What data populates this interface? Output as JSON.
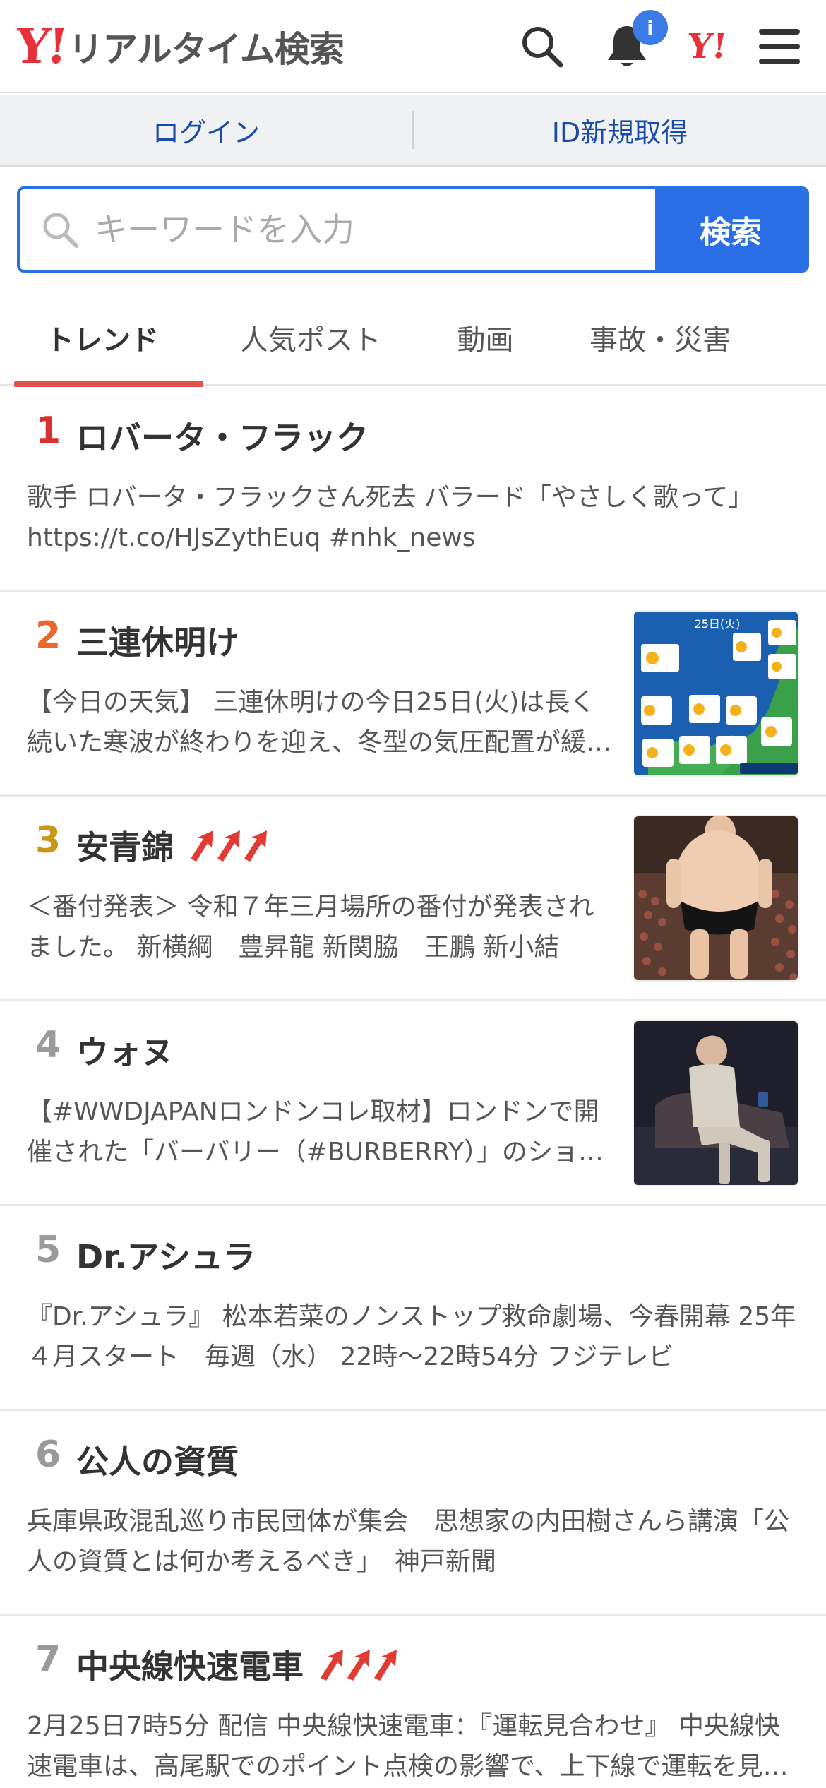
{
  "header": {
    "logo_mark": "Y!",
    "logo_text": "リアルタイム検索",
    "notification_badge": "i",
    "yahoo_mark": "Y!"
  },
  "login_bar": {
    "login_label": "ログイン",
    "signup_label": "ID新規取得"
  },
  "search": {
    "placeholder": "キーワードを入力",
    "button_label": "検索"
  },
  "tabs": [
    {
      "label": "トレンド",
      "active": true
    },
    {
      "label": "人気ポスト",
      "active": false
    },
    {
      "label": "動画",
      "active": false
    },
    {
      "label": "事故・災害",
      "active": false
    }
  ],
  "colors": {
    "brand_red": "#e8303a",
    "accent_blue": "#2a6fe6",
    "rank_1": "#d9312f",
    "rank_2": "#e8692a",
    "rank_3": "#c9961a",
    "rank_other": "#9a9a9a",
    "arrow": "#e23b33"
  },
  "trends": [
    {
      "rank": "1",
      "title": "ロバータ・フラック",
      "description": "歌手 ロバータ・フラックさん死去 バラード「やさしく歌って」 https://t.co/HJsZythEuq #nhk_news",
      "rising": false,
      "thumbnail": null
    },
    {
      "rank": "2",
      "title": "三連休明け",
      "description": "【今日の天気】 三連休明けの今日25日(火)は長く続いた寒波が終わりを迎え、冬型の気圧配置が緩みます。",
      "rising": false,
      "thumbnail": "weather-map"
    },
    {
      "rank": "3",
      "title": "安青錦",
      "description": "＜番付発表＞ 令和７年三月場所の番付が発表されました。 新横綱　豊昇龍 新関脇　王鵬 新小結",
      "rising": true,
      "thumbnail": "sumo-wrestler"
    },
    {
      "rank": "4",
      "title": "ウォヌ",
      "description": "【#WWDJAPANロンドンコレ取材】ロンドンで開催された「バーバリー（#BURBERRY）」のショーに",
      "rising": false,
      "thumbnail": "seated-man"
    },
    {
      "rank": "5",
      "title": "Dr.アシュラ",
      "description": "『Dr.アシュラ』 松本若菜のノンストップ救命劇場、今春開幕 25年４月スタート　毎週（水） 22時～22時54分 フジテレビ",
      "rising": false,
      "thumbnail": null
    },
    {
      "rank": "6",
      "title": "公人の資質",
      "description": "兵庫県政混乱巡り市民団体が集会　思想家の内田樹さんら講演「公人の資質とは何か考えるべき」　神戸新聞",
      "rising": false,
      "thumbnail": null
    },
    {
      "rank": "7",
      "title": "中央線快速電車",
      "description": "2月25日7時5分 配信 中央線快速電車：『運転見合わせ』 中央線快速電車は、高尾駅でのポイント点検の影響で、上下線で運転を見合わせています。",
      "rising": true,
      "thumbnail": null
    }
  ],
  "weather_thumb": {
    "date_label": "25日(火)"
  }
}
